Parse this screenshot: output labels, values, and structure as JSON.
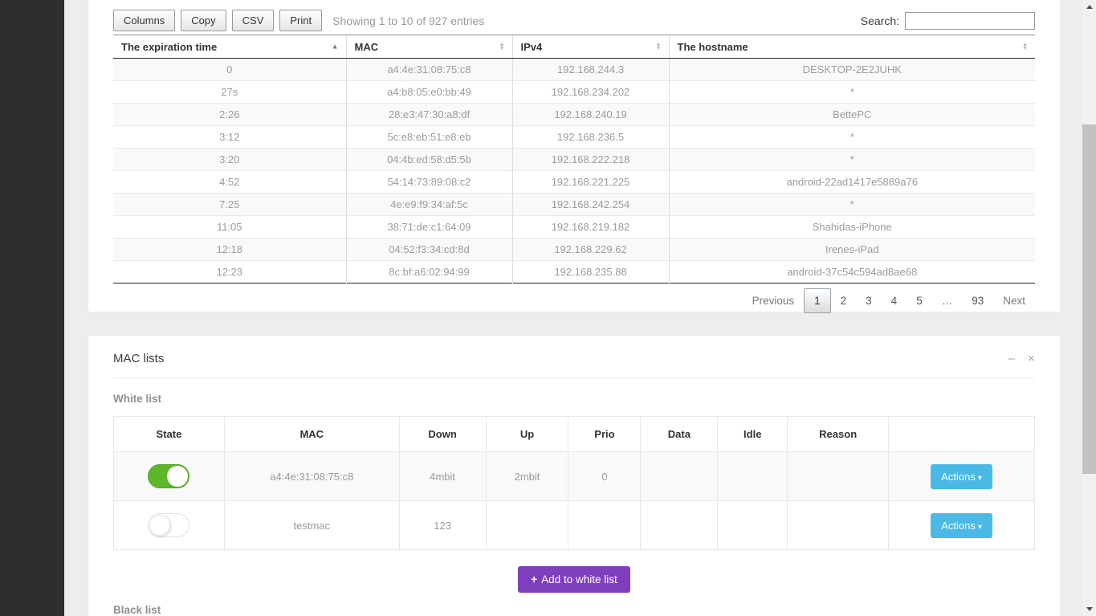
{
  "toolbar": {
    "buttons": [
      "Columns",
      "Copy",
      "CSV",
      "Print"
    ],
    "showing_text": "Showing 1 to 10 of 927 entries",
    "search_label": "Search:",
    "search_value": ""
  },
  "leases_table": {
    "columns": [
      {
        "label": "The expiration time",
        "sort": "asc"
      },
      {
        "label": "MAC",
        "sort": "none"
      },
      {
        "label": "IPv4",
        "sort": "none"
      },
      {
        "label": "The hostname",
        "sort": "none"
      }
    ],
    "rows": [
      [
        "0",
        "a4:4e:31:08:75:c8",
        "192.168.244.3",
        "DESKTOP-2E2JUHK"
      ],
      [
        "27s",
        "a4:b8:05:e0:bb:49",
        "192.168.234.202",
        "*"
      ],
      [
        "2:26",
        "28:e3:47:30:a8:df",
        "192.168.240.19",
        "BettePC"
      ],
      [
        "3:12",
        "5c:e8:eb:51:e8:eb",
        "192.168.236.5",
        "*"
      ],
      [
        "3:20",
        "04:4b:ed:58:d5:5b",
        "192.168.222.218",
        "*"
      ],
      [
        "4:52",
        "54:14:73:89:08:c2",
        "192.168.221.225",
        "android-22ad1417e5889a76"
      ],
      [
        "7:25",
        "4e:e9:f9:34:af:5c",
        "192.168.242.254",
        "*"
      ],
      [
        "11:05",
        "38:71:de:c1:64:09",
        "192.168.219.182",
        "Shahidas-iPhone"
      ],
      [
        "12:18",
        "04:52:f3:34:cd:8d",
        "192.168.229.62",
        "Irenes-iPad"
      ],
      [
        "12:23",
        "8c:bf:a6:02:94:99",
        "192.168.235.88",
        "android-37c54c594ad8ae68"
      ]
    ]
  },
  "pagination": {
    "previous": "Previous",
    "pages": [
      "1",
      "2",
      "3",
      "4",
      "5",
      "…",
      "93"
    ],
    "active_page": "1",
    "next": "Next"
  },
  "mac_lists": {
    "title": "MAC lists",
    "white_list": {
      "heading": "White list",
      "columns": [
        "State",
        "MAC",
        "Down",
        "Up",
        "Prio",
        "Data",
        "Idle",
        "Reason",
        ""
      ],
      "rows": [
        {
          "state": "on",
          "mac": "a4:4e:31:08:75:c8",
          "down": "4mbit",
          "up": "2mbit",
          "prio": "0",
          "data": "",
          "idle": "",
          "reason": "",
          "action_label": "Actions"
        },
        {
          "state": "off",
          "mac": "testmac",
          "down": "123",
          "up": "",
          "prio": "",
          "data": "",
          "idle": "",
          "reason": "",
          "action_label": "Actions"
        }
      ],
      "add_button_label": "Add to white list"
    },
    "black_list": {
      "heading": "Black list"
    }
  },
  "icons": {
    "sort_asc": "▲",
    "sort_up": "▲",
    "sort_down": "▼",
    "caret_down": "▾",
    "plus": "+",
    "minimize": "–",
    "close": "×"
  },
  "colors": {
    "sidebar_bg": "#2c2e30",
    "page_bg": "#ededed",
    "toggle_on_green": "#5db829",
    "actions_blue": "#4ab9e6",
    "add_purple": "#7e3fbf",
    "striped_row": "#f9f9f9"
  }
}
